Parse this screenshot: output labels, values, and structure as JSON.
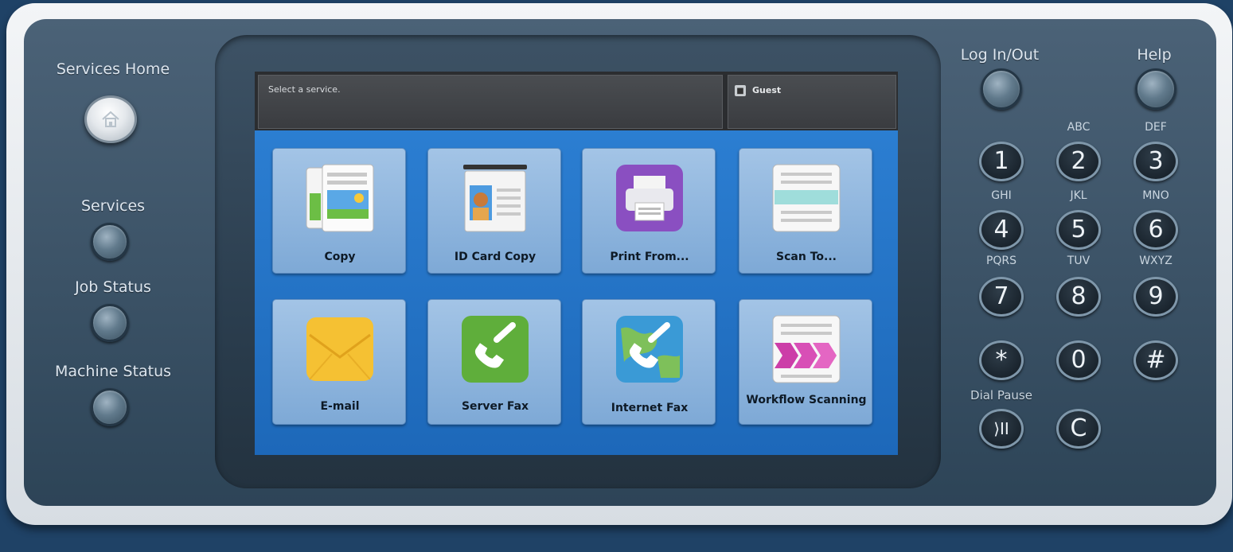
{
  "left_buttons": {
    "services_home": "Services Home",
    "services": "Services",
    "job_status": "Job Status",
    "machine_status": "Machine Status"
  },
  "screen": {
    "message": "Select a service.",
    "user": "Guest",
    "user_icon": "person-badge-icon",
    "tiles": [
      {
        "label": "Copy",
        "icon": "copy-icon"
      },
      {
        "label": "ID Card Copy",
        "icon": "id-card-icon"
      },
      {
        "label": "Print From...",
        "icon": "printer-icon"
      },
      {
        "label": "Scan To...",
        "icon": "scanner-icon"
      },
      {
        "label": "E-mail",
        "icon": "envelope-icon"
      },
      {
        "label": "Server Fax",
        "icon": "phone-icon"
      },
      {
        "label": "Internet Fax",
        "icon": "globe-phone-icon"
      },
      {
        "label": "Workflow Scanning",
        "icon": "workflow-arrows-icon"
      }
    ]
  },
  "right_buttons": {
    "log_in_out": "Log In/Out",
    "help": "Help"
  },
  "keypad": {
    "keys": [
      {
        "digit": "1",
        "letters": ""
      },
      {
        "digit": "2",
        "letters": "ABC"
      },
      {
        "digit": "3",
        "letters": "DEF"
      },
      {
        "digit": "4",
        "letters": "GHI"
      },
      {
        "digit": "5",
        "letters": "JKL"
      },
      {
        "digit": "6",
        "letters": "MNO"
      },
      {
        "digit": "7",
        "letters": "PQRS"
      },
      {
        "digit": "8",
        "letters": "TUV"
      },
      {
        "digit": "9",
        "letters": "WXYZ"
      },
      {
        "digit": "*",
        "letters": ""
      },
      {
        "digit": "0",
        "letters": ""
      },
      {
        "digit": "#",
        "letters": ""
      }
    ],
    "dial_pause": "Dial Pause",
    "dial_pause_symbol": "⟩II",
    "clear": "C"
  },
  "colors": {
    "screen_blue": "#1e6fc2",
    "panel": "#3b5266",
    "tile": "#8fb6de"
  }
}
